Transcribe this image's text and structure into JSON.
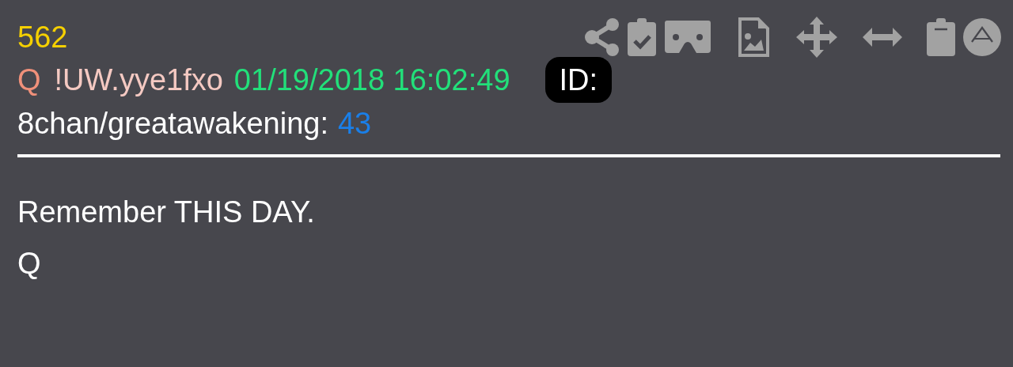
{
  "post": {
    "number": "562",
    "author": "Q",
    "tripcode": "!UW.yye1fxo",
    "timestamp": "01/19/2018 16:02:49",
    "id_badge": "ID:",
    "board": "8chan/greatawakening:",
    "thread": "43",
    "body": [
      "Remember THIS DAY.",
      "Q"
    ]
  }
}
